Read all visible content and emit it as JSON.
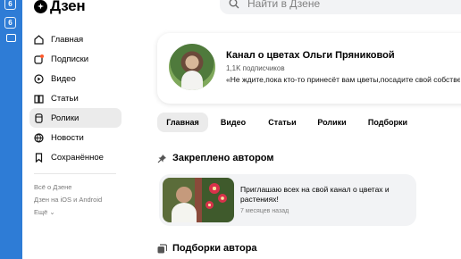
{
  "system_strip": {
    "buttons": [
      "6",
      "6"
    ]
  },
  "logo": {
    "text": "Дзен"
  },
  "search": {
    "placeholder": "Найти в Дзене"
  },
  "sidebar": {
    "items": [
      {
        "label": "Главная",
        "icon": "home-icon",
        "active": false
      },
      {
        "label": "Подписки",
        "icon": "subscriptions-icon",
        "active": false,
        "badge_color": "#ff5a2c"
      },
      {
        "label": "Видео",
        "icon": "video-icon",
        "active": false
      },
      {
        "label": "Статьи",
        "icon": "articles-icon",
        "active": false
      },
      {
        "label": "Ролики",
        "icon": "shorts-icon",
        "active": true
      },
      {
        "label": "Новости",
        "icon": "news-icon",
        "active": false
      },
      {
        "label": "Сохранённое",
        "icon": "bookmark-icon",
        "active": false
      }
    ],
    "links": [
      "Всё о Дзене",
      "Дзен на iOS и Android",
      "Ещё ⌄"
    ]
  },
  "channel": {
    "title": "Канал о цветах Ольги Пряниковой",
    "subscribers": "1,1K подписчиков",
    "description": "«Не ждите,пока кто-то принесёт вам цветы,посадите свой собствен"
  },
  "tabs": [
    {
      "label": "Главная",
      "active": true
    },
    {
      "label": "Видео",
      "active": false
    },
    {
      "label": "Статьи",
      "active": false
    },
    {
      "label": "Ролики",
      "active": false
    },
    {
      "label": "Подборки",
      "active": false
    }
  ],
  "pinned_section": {
    "title": "Закреплено автором"
  },
  "pinned_post": {
    "text": "Приглашаю всех на свой канал о цветах и растениях!",
    "time": "7 месяцев назад"
  },
  "collections_section": {
    "title": "Подборки автора"
  },
  "colors": {
    "accent_blue": "#2e7cd6",
    "active_bg": "#ebebeb",
    "card_bg": "#f2f3f5"
  }
}
